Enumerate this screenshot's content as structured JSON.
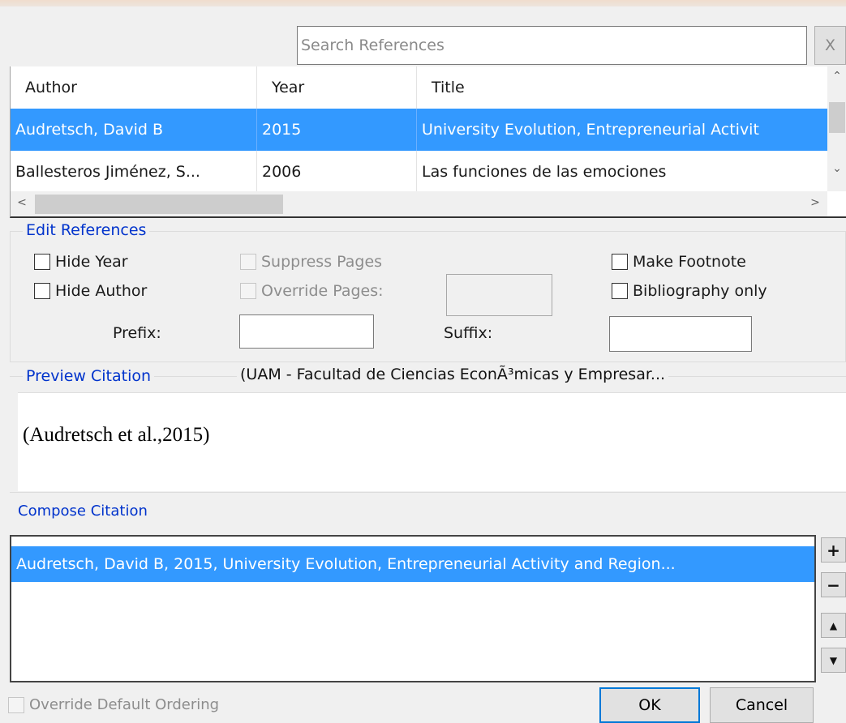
{
  "search": {
    "placeholder": "Search References",
    "value": "",
    "clear_label": "X"
  },
  "table": {
    "columns": [
      "Author",
      "Year",
      "Title"
    ],
    "rows": [
      {
        "author": "Audretsch, David B",
        "year": "2015",
        "title": "University Evolution, Entrepreneurial Activit",
        "selected": true
      },
      {
        "author": "Ballesteros Jiménez, S...",
        "year": "2006",
        "title": "Las funciones de las emociones",
        "selected": false
      }
    ]
  },
  "edit_references": {
    "legend": "Edit References",
    "hide_year": "Hide Year",
    "hide_author": "Hide Author",
    "suppress_pages": "Suppress Pages",
    "override_pages": "Override Pages:",
    "make_footnote": "Make Footnote",
    "bibliography_only": "Bibliography only",
    "prefix_label": "Prefix:",
    "suffix_label": "Suffix:",
    "prefix_value": "",
    "suffix_value": "",
    "override_pages_value": ""
  },
  "preview": {
    "legend": "Preview Citation",
    "style_name": "(UAM - Facultad de Ciencias EconÃ³micas y Empresar...",
    "citation": "(Audretsch et al.,2015)"
  },
  "compose": {
    "label": "Compose Citation",
    "items": [
      "Audretsch, David B, 2015, University Evolution, Entrepreneurial Activity and Region..."
    ],
    "add_label": "+",
    "remove_label": "−",
    "up_label": "▲",
    "down_label": "▼"
  },
  "footer": {
    "override_ordering": "Override Default Ordering",
    "ok": "OK",
    "cancel": "Cancel"
  },
  "colors": {
    "selection": "#3399ff",
    "legend_text": "#0033cc",
    "default_button_border": "#0078d7"
  }
}
